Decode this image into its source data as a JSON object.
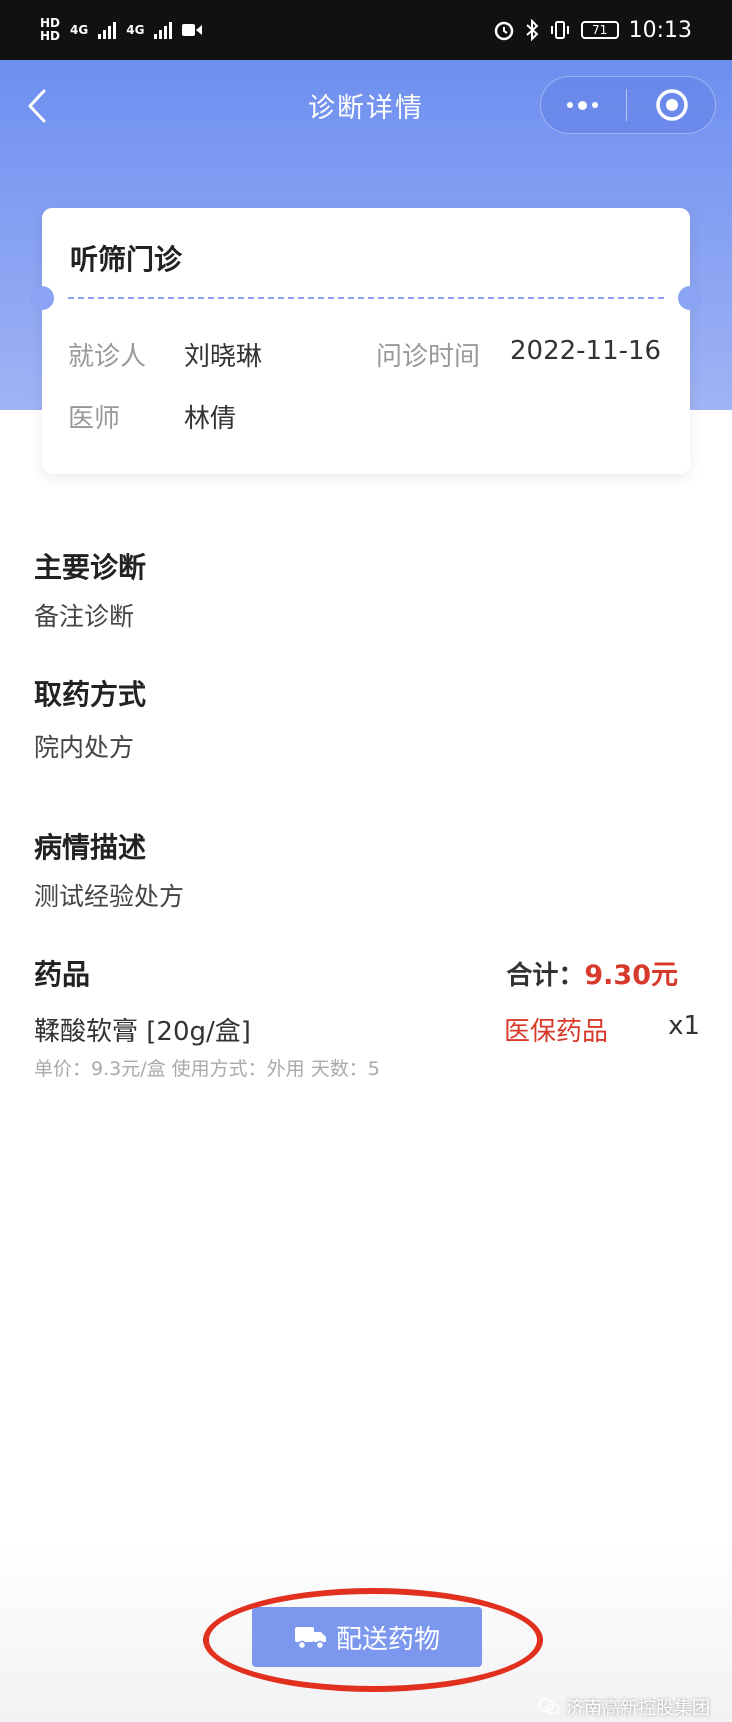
{
  "status_bar": {
    "hd1": "HD",
    "hd2": "HD",
    "net1": "4G",
    "net2": "4G",
    "battery": "71",
    "time": "10:13"
  },
  "navbar": {
    "title": "诊断详情"
  },
  "card": {
    "title": "听筛门诊",
    "patient_label": "就诊人",
    "patient_value": "刘晓琳",
    "time_label": "问诊时间",
    "time_value": "2022-11-16",
    "doctor_label": "医师",
    "doctor_value": "林倩"
  },
  "sections": {
    "diagnosis_title": "主要诊断",
    "diagnosis_value": "备注诊断",
    "pickup_title": "取药方式",
    "pickup_value": "院内处方",
    "condition_title": "病情描述",
    "condition_value": "测试经验处方"
  },
  "drugs": {
    "title": "药品",
    "total_label": "合计：",
    "total_amount": "9.30元",
    "items": [
      {
        "name": "鞣酸软膏 [20g/盒]",
        "tag": "医保药品",
        "qty": "x1",
        "meta": "单价：9.3元/盒 使用方式：外用 天数：5"
      }
    ]
  },
  "footer": {
    "deliver_label": "配送药物"
  },
  "watermark": "济南高新控股集团",
  "colors": {
    "accent": "#7c97ee",
    "price_red": "#d73a2a",
    "annotation_red": "#e2301f"
  }
}
